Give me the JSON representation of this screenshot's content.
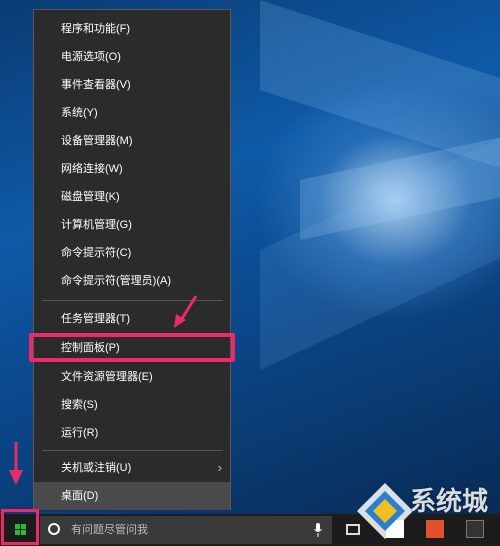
{
  "menu": {
    "items": [
      {
        "label": "程序和功能(F)"
      },
      {
        "label": "电源选项(O)"
      },
      {
        "label": "事件查看器(V)"
      },
      {
        "label": "系统(Y)"
      },
      {
        "label": "设备管理器(M)"
      },
      {
        "label": "网络连接(W)"
      },
      {
        "label": "磁盘管理(K)"
      },
      {
        "label": "计算机管理(G)"
      },
      {
        "label": "命令提示符(C)"
      },
      {
        "label": "命令提示符(管理员)(A)"
      },
      {
        "label": "任务管理器(T)"
      },
      {
        "label": "控制面板(P)"
      },
      {
        "label": "文件资源管理器(E)"
      },
      {
        "label": "搜索(S)"
      },
      {
        "label": "运行(R)"
      },
      {
        "label": "关机或注销(U)",
        "submenu_icon": "chevron-right-icon"
      },
      {
        "label": "桌面(D)"
      }
    ]
  },
  "taskbar": {
    "search_placeholder": "有问题尽管问我",
    "start_icon": "windows-logo-icon"
  },
  "annotations": {
    "highlight_color": "#ec2a6a",
    "highlighted_item": "控制面板(P)"
  },
  "watermark": {
    "text": "系统城"
  }
}
